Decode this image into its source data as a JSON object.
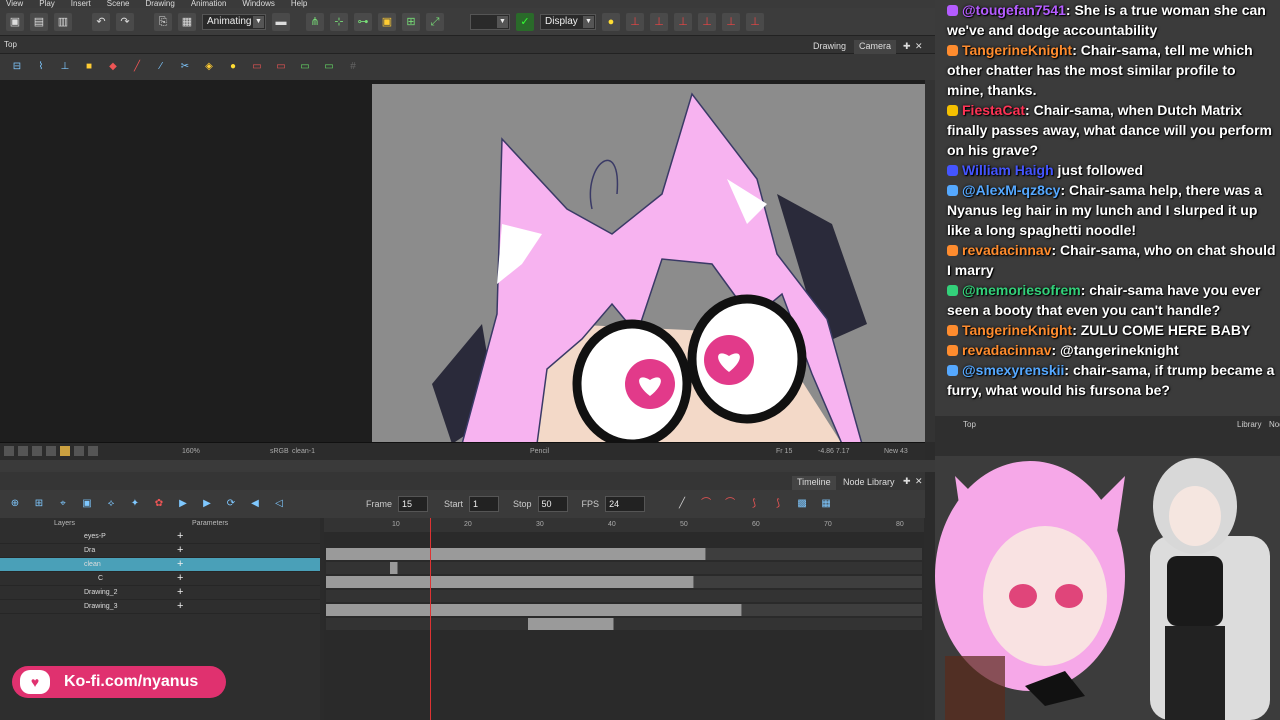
{
  "menu": [
    "View",
    "Play",
    "Insert",
    "Scene",
    "Drawing",
    "Animation",
    "Windows",
    "Help"
  ],
  "toolbar": {
    "mode_select": "Animating",
    "display_select": "Display"
  },
  "camera_view": {
    "top_label": "Top",
    "tabs": [
      "Drawing",
      "Camera"
    ]
  },
  "statusbar": {
    "zoom": "160%",
    "color_space": "sRGB",
    "layer": "clean-1",
    "tool": "Pencil",
    "frame": "Fr 15",
    "coords": "-4.86 7.17",
    "new": "New 43"
  },
  "timeline": {
    "tabs": [
      "Timeline",
      "Node Library"
    ],
    "frame_label": "Frame",
    "frame_value": "15",
    "start_label": "Start",
    "start_value": "1",
    "stop_label": "Stop",
    "stop_value": "50",
    "fps_label": "FPS",
    "fps_value": "24",
    "layers_header": "Layers",
    "params_header": "Parameters",
    "ruler_ticks": [
      "10",
      "20",
      "30",
      "40",
      "50",
      "60",
      "70",
      "80"
    ],
    "layers": [
      {
        "name": "eyes-P"
      },
      {
        "name": "Dra"
      },
      {
        "name": "clean"
      },
      {
        "name": "C"
      },
      {
        "name": "Drawing_2"
      },
      {
        "name": "Drawing_3"
      }
    ]
  },
  "kofi": {
    "text": "Ko-fi.com/nyanus"
  },
  "chat": {
    "messages": [
      {
        "user": "@tougefan7541",
        "user_color": "#b45cff",
        "text": ": She is a true woman she can we've and dodge accountability"
      },
      {
        "user": "TangerineKnight",
        "user_color": "#ff8c2e",
        "text": ": Chair-sama, tell me which other chatter has the most similar profile to mine, thanks."
      },
      {
        "user": "FiestaCat",
        "user_color": "#ff3355",
        "text": ": Chair-sama, when Dutch Matrix finally passes away, what dance will you perform on his grave?"
      },
      {
        "user": "William Haigh",
        "user_color": "#4455ff",
        "text": " just followed"
      },
      {
        "user": "@AlexM-qz8cy",
        "user_color": "#55a8ff",
        "text": ": Chair-sama help, there was a Nyanus leg hair in my lunch and I slurped it up like a long spaghetti noodle!"
      },
      {
        "user": "revadacinnav",
        "user_color": "#ff8c2e",
        "text": ": Chair-sama, who on chat should I marry"
      },
      {
        "user": "@memoriesofrem",
        "user_color": "#33d17a",
        "text": ": chair-sama have you ever seen a booty that even you can't handle?"
      },
      {
        "user": "TangerineKnight",
        "user_color": "#ff8c2e",
        "text": ": ZULU COME HERE BABY"
      },
      {
        "user": "revadacinnav",
        "user_color": "#ff8c2e",
        "text": ": @tangerineknight"
      },
      {
        "user": "@smexyrenskii",
        "user_color": "#55a8ff",
        "text": ": chair-sama, if trump became a furry, what would his fursona be?"
      }
    ]
  },
  "right_panel": {
    "top_label": "Top",
    "tabs": [
      "Library",
      "Node"
    ]
  },
  "colors": {
    "accent_teal": "#4aa0b8",
    "kofi_red": "#e0316f",
    "playhead_red": "#d33333"
  }
}
